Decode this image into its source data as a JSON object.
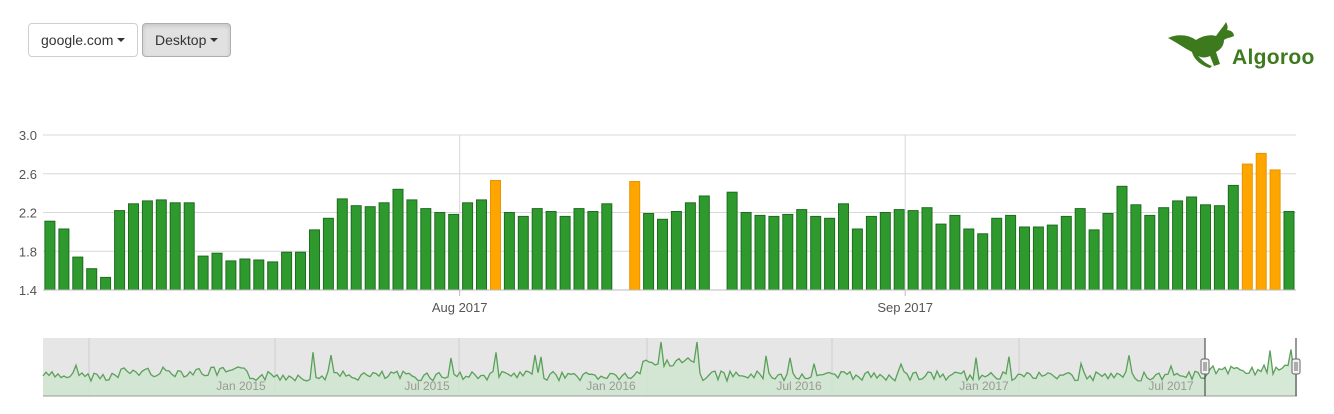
{
  "toolbar": {
    "site_label": "google.com",
    "device_label": "Desktop"
  },
  "brand": {
    "name": "Algoroo",
    "logo_icon": "kangaroo-icon",
    "color": "#3d7a1e"
  },
  "colors": {
    "bar_normal": "#2e9a2e",
    "bar_normal_edge": "#1f6b1f",
    "bar_high": "#ffa500",
    "navigator_line": "#5aa05a",
    "navigator_fill": "#cfe4cf"
  },
  "chart_data": {
    "type": "bar",
    "title": "",
    "xlabel": "",
    "ylabel": "",
    "ylim": [
      1.4,
      3.0
    ],
    "y_ticks": [
      "3.0",
      "2.6",
      "2.2",
      "1.8",
      "1.4"
    ],
    "x_ticks": [
      "Aug 2017",
      "Sep 2017"
    ],
    "grid": true,
    "series": [
      {
        "values": [
          2.11,
          2.03,
          1.74,
          1.62,
          1.53,
          2.22,
          2.29,
          2.32,
          2.33,
          2.3,
          2.3,
          1.75,
          1.78,
          1.7,
          1.72,
          1.71,
          1.69,
          1.79,
          1.79,
          2.02,
          2.14,
          2.34,
          2.27,
          2.26,
          2.3,
          2.44,
          2.33,
          2.24,
          2.2,
          2.18,
          2.3,
          2.33,
          2.53,
          2.2,
          2.16,
          2.24,
          2.21,
          2.16,
          2.24,
          2.21,
          2.29,
          null,
          2.52,
          2.19,
          2.13,
          2.21,
          2.3,
          2.37,
          null,
          2.41,
          2.2,
          2.17,
          2.16,
          2.18,
          2.23,
          2.16,
          2.14,
          2.29,
          2.03,
          2.16,
          2.2,
          2.23,
          2.22,
          2.25,
          2.08,
          2.17,
          2.03,
          1.98,
          2.14,
          2.17,
          2.05,
          2.05,
          2.07,
          2.16,
          2.24,
          2.02,
          2.19,
          2.47,
          2.28,
          2.17,
          2.25,
          2.32,
          2.36,
          2.28,
          2.27,
          2.48,
          2.7,
          2.81,
          2.64,
          2.21
        ],
        "highlight": [
          32,
          42,
          86,
          87,
          88
        ]
      }
    ],
    "navigator": {
      "x_ticks": [
        "Jan 2015",
        "Jul 2015",
        "Jan 2016",
        "Jul 2016",
        "Jan 2017",
        "Jul 2017"
      ],
      "selected_from": "Jul 2017"
    }
  }
}
